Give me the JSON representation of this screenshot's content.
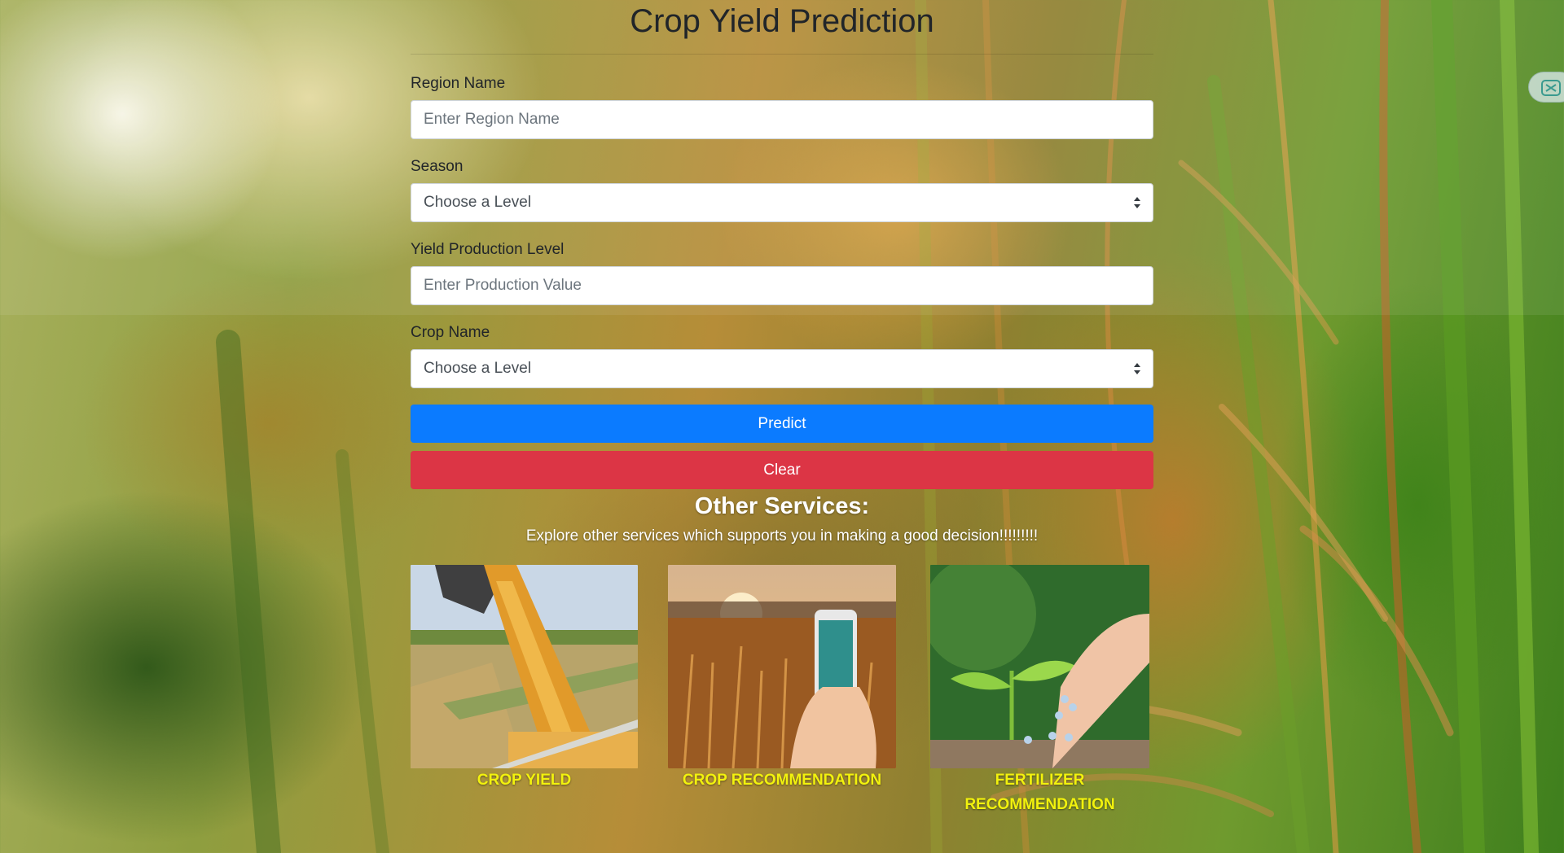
{
  "page": {
    "title": "Crop Yield Prediction"
  },
  "form": {
    "region": {
      "label": "Region Name",
      "placeholder": "Enter Region Name"
    },
    "season": {
      "label": "Season",
      "selected": "Choose a Level"
    },
    "yield_level": {
      "label": "Yield Production Level",
      "placeholder": "Enter Production Value"
    },
    "crop": {
      "label": "Crop Name",
      "selected": "Choose a Level"
    },
    "predict_label": "Predict",
    "clear_label": "Clear"
  },
  "services": {
    "heading": "Other Services:",
    "subtitle": "Explore other services which supports you in making a good decision!!!!!!!!!",
    "cards": [
      {
        "caption": "CROP YIELD",
        "icon": "grain-harvest-image"
      },
      {
        "caption": "CROP RECOMMENDATION",
        "icon": "phone-in-wheat-field-image"
      },
      {
        "caption": "FERTILIZER RECOMMENDATION",
        "icon": "seedling-fertilizer-image"
      }
    ]
  },
  "colors": {
    "primary": "#0b7bff",
    "danger": "#dc3545",
    "caption": "#f2f20d"
  },
  "extension_icon": "extension-icon"
}
